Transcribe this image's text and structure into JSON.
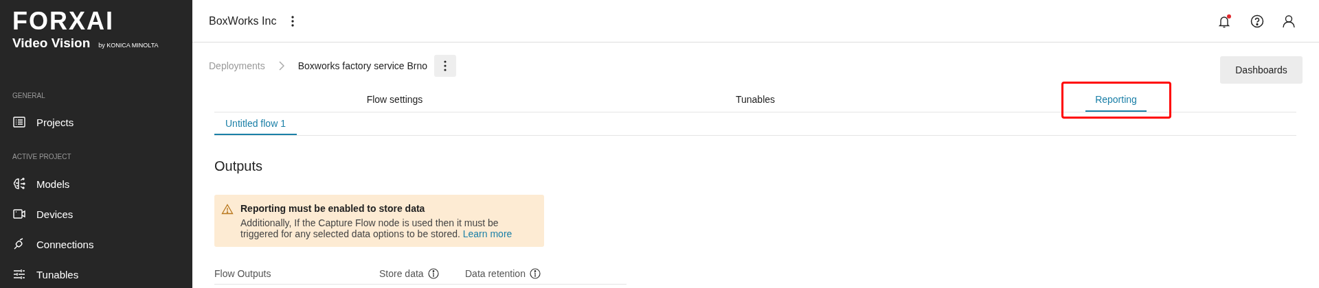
{
  "brand": {
    "logo": "FORXAI",
    "product": "Video Vision",
    "maker": "by KONICA MINOLTA"
  },
  "sidebar": {
    "sections": [
      {
        "label": "GENERAL",
        "items": [
          {
            "label": "Projects"
          }
        ]
      },
      {
        "label": "ACTIVE PROJECT",
        "items": [
          {
            "label": "Models"
          },
          {
            "label": "Devices"
          },
          {
            "label": "Connections"
          },
          {
            "label": "Tunables"
          }
        ]
      }
    ]
  },
  "header": {
    "organization": "BoxWorks Inc",
    "notifications_unread": true
  },
  "breadcrumb": [
    {
      "label": "Deployments",
      "current": false
    },
    {
      "label": "Boxworks factory service Brno",
      "current": true
    }
  ],
  "dashboards_button": "Dashboards",
  "tabs": [
    {
      "label": "Flow settings",
      "selected": false,
      "highlighted": false
    },
    {
      "label": "Tunables",
      "selected": false,
      "highlighted": false
    },
    {
      "label": "Reporting",
      "selected": true,
      "highlighted": true
    }
  ],
  "flow_tabs": [
    {
      "label": "Untitled flow 1",
      "selected": true
    }
  ],
  "section_title": "Outputs",
  "alert": {
    "title": "Reporting must be enabled to store data",
    "text": "Additionally, If the Capture Flow node is used then it must be triggered for any selected data options to be stored.",
    "link": "Learn more"
  },
  "table": {
    "columns": [
      {
        "label": "Flow Outputs",
        "info": false
      },
      {
        "label": "Store data",
        "info": true
      },
      {
        "label": "Data retention",
        "info": true
      }
    ]
  }
}
